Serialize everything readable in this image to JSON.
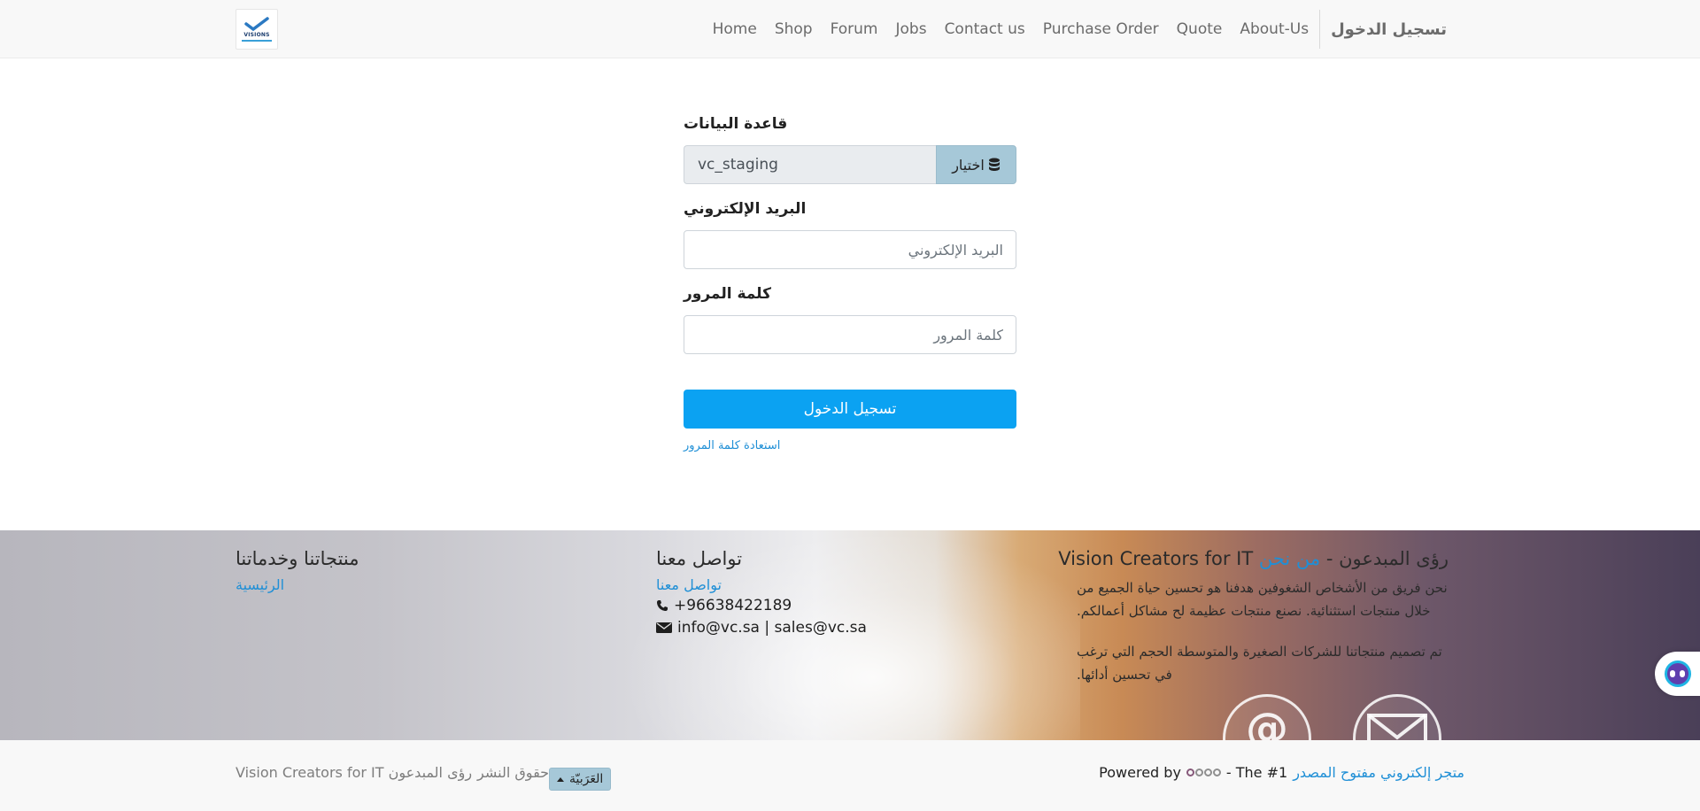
{
  "colors": {
    "primary": "#0ba2f2",
    "link": "#1f8fd6",
    "secondary_button": "#a6c8d8",
    "navbar_bg": "#f8f8f8"
  },
  "header": {
    "logo_text": "VISIONS",
    "nav": [
      {
        "label": "Home"
      },
      {
        "label": "Shop"
      },
      {
        "label": "Forum"
      },
      {
        "label": "Jobs"
      },
      {
        "label": "Contact us"
      },
      {
        "label": "Purchase Order"
      },
      {
        "label": "Quote"
      },
      {
        "label": "About-Us"
      }
    ],
    "sign_in": "تسجيل الدخول"
  },
  "login": {
    "database_label": "قاعدة البيانات",
    "database_value": "vc_staging",
    "database_select": "اختيار",
    "database_icon": "database-icon",
    "email_label": "البريد الإلكتروني",
    "email_placeholder": "البريد الإلكتروني",
    "password_label": "كلمة المرور",
    "password_placeholder": "كلمة المرور",
    "submit": "تسجيل الدخول",
    "reset_password": "استعادة كلمة المرور"
  },
  "footer": {
    "products": {
      "heading": "منتجاتنا وخدماتنا",
      "links": [
        "الرئيسية"
      ]
    },
    "contact": {
      "heading": "تواصل معنا",
      "link": "تواصل معنا",
      "phone": "+96638422189",
      "email": "info@vc.sa | sales@vc.sa",
      "phone_icon": "phone-icon",
      "email_icon": "envelope-icon"
    },
    "about": {
      "heading_prefix": "رؤى المبدعون - ",
      "heading_link": "من نحن",
      "heading_suffix": " Vision Creators for IT",
      "paragraph_1": "نحن فريق من الأشخاص الشغوفين هدفنا هو تحسين حياة الجميع من خلال منتجات استثنائية. نصنع منتجات عظيمة لح مشاكل أعمالكم.",
      "paragraph_2": "تم تصميم منتجاتنا للشركات الصغيرة والمتوسطة الحجم التي ترغب في تحسين أدائها."
    }
  },
  "bottom_bar": {
    "copyright": "حقوق النشر",
    "company": "رؤى المبدعون Vision Creators for IT",
    "language": "العَرَبيّة",
    "powered_by": "Powered by",
    "the_1": "- The #1",
    "ecommerce_link": "متجر إلكتروني مفتوح المصدر"
  }
}
